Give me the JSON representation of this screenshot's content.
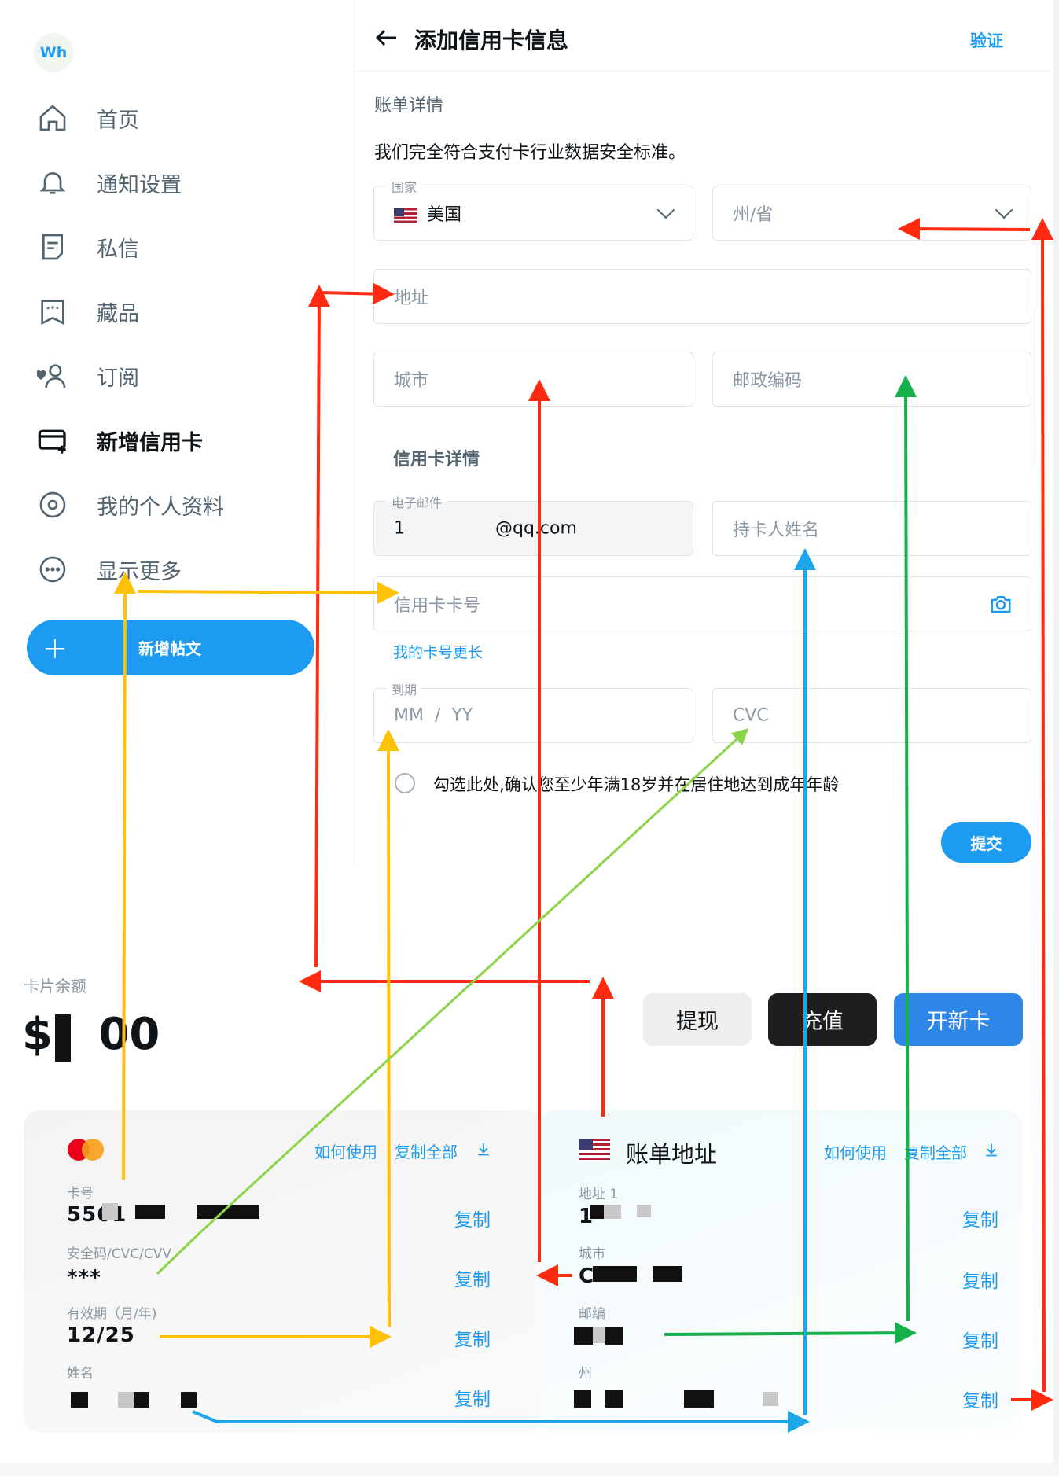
{
  "logo": "Wh",
  "nav": [
    {
      "label": "首页",
      "icon": "home-icon"
    },
    {
      "label": "通知设置",
      "icon": "bell-icon"
    },
    {
      "label": "私信",
      "icon": "message-icon"
    },
    {
      "label": "藏品",
      "icon": "collections-icon"
    },
    {
      "label": "订阅",
      "icon": "subscriptions-icon"
    },
    {
      "label": "新增信用卡",
      "icon": "credit-card-icon"
    },
    {
      "label": "我的个人资料",
      "icon": "profile-icon"
    },
    {
      "label": "显示更多",
      "icon": "more-icon"
    }
  ],
  "new_post": "新增帖文",
  "header": {
    "title": "添加信用卡信息",
    "verify": "验证"
  },
  "billing": {
    "title": "账单详情",
    "pci": "我们完全符合支付卡行业数据安全标准。",
    "country_label": "国家",
    "country_value": "美国",
    "state_placeholder": "州/省",
    "address_placeholder": "地址",
    "city_placeholder": "城市",
    "zip_placeholder": "邮政编码"
  },
  "card": {
    "title": "信用卡详情",
    "email_label": "电子邮件",
    "email_value_start": "1",
    "email_value_end": "@qq.com",
    "holder_placeholder": "持卡人姓名",
    "number_placeholder": "信用卡卡号",
    "longer_link": "我的卡号更长",
    "expiry_label": "到期",
    "expiry_placeholder": "MM  /  YY",
    "cvc_placeholder": "CVC",
    "consent": "勾选此处,确认您至少年满18岁并在居住地达到成年年龄",
    "submit": "提交"
  },
  "balance": {
    "label": "卡片余额",
    "value": "$   00"
  },
  "actions": {
    "withdraw": "提现",
    "topup": "充值",
    "new_card": "开新卡"
  },
  "left_panel": {
    "how": "如何使用",
    "copy_all": "复制全部",
    "number_label": "卡号",
    "number_value": "5561",
    "cvc_label": "安全码/CVC/CVV",
    "cvc_value": "***",
    "expiry_label": "有效期（月/年)",
    "expiry_value": "12/25",
    "name_label": "姓名",
    "copy": "复制"
  },
  "right_panel": {
    "title": "账单地址",
    "how": "如何使用",
    "copy_all": "复制全部",
    "address_label": "地址 1",
    "address_value": "1",
    "city_label": "城市",
    "city_value": "C",
    "zip_label": "邮编",
    "state_label": "州",
    "copy": "复制"
  },
  "colors": {
    "accent": "#1d9bf0",
    "arrow_red": "#ff2a10",
    "arrow_yellow": "#ffc107",
    "arrow_green": "#16b04a",
    "arrow_blue": "#1ea6ea",
    "arrow_lime": "#8bd44a"
  }
}
